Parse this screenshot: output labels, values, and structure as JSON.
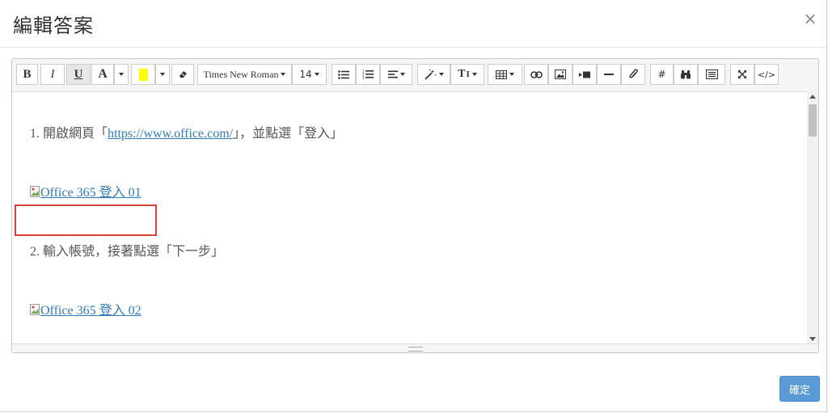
{
  "dialog": {
    "title": "編輯答案",
    "close_glyph": "×",
    "confirm_label": "確定"
  },
  "toolbar": {
    "bold_label": "B",
    "italic_label": "I",
    "underline_label": "U",
    "font_color_label": "A",
    "highlight_color": "#ffff00",
    "font_family": "Times New Roman",
    "font_size": "14",
    "style_label": "T",
    "hash_label": "#",
    "code_view_label": "</>",
    "icons": [
      "bold",
      "italic",
      "underline",
      "font-color",
      "highlight",
      "eraser",
      "font-family",
      "font-size",
      "unordered-list",
      "ordered-list",
      "align",
      "magic-wand",
      "text-style",
      "table",
      "link",
      "image",
      "video",
      "horizontal-rule",
      "attachment",
      "hash",
      "binoculars",
      "template",
      "fullscreen",
      "code-view"
    ]
  },
  "content": {
    "step1_prefix": "1. 開啟網頁「",
    "step1_link": "https://www.office.com/",
    "step1_suffix": "」，並點選「登入」",
    "image1_alt": "Office 365 登入 01",
    "step2_text": "2. 輸入帳號，接著點選「下一步」",
    "image2_alt": "Office 365 登入 02"
  },
  "colors": {
    "accent": "#5b9bd5",
    "link": "#337ab7",
    "highlight_box": "#d9413a"
  }
}
